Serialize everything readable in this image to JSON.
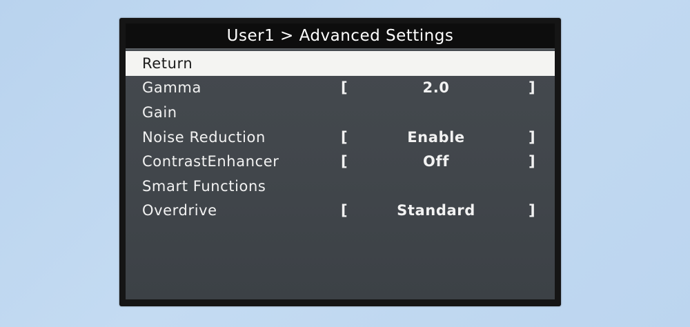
{
  "menu": {
    "title": "User1 > Advanced Settings",
    "items": [
      {
        "label": "Return",
        "value": null
      },
      {
        "label": "Gamma",
        "value": "2.0"
      },
      {
        "label": "Gain",
        "value": null
      },
      {
        "label": "Noise Reduction",
        "value": "Enable"
      },
      {
        "label": "ContrastEnhancer",
        "value": "Off"
      },
      {
        "label": "Smart Functions",
        "value": null
      },
      {
        "label": "Overdrive",
        "value": "Standard"
      }
    ],
    "bracket_open": "[",
    "bracket_close": "]",
    "selected_item": "Return"
  },
  "colors": {
    "background": "#bfd7f0",
    "menu_background": "#44494e",
    "title_background": "#0d0d0d",
    "highlight": "#f4f4f2",
    "text": "#f2f2f2"
  }
}
